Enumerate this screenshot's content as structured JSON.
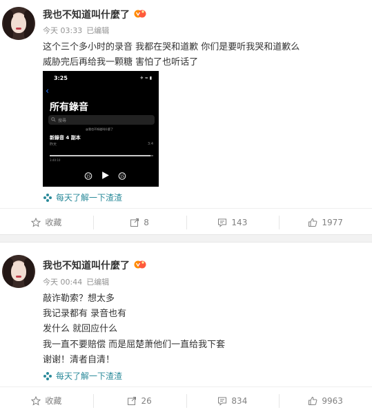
{
  "posts": [
    {
      "username": "我也不知道叫什麼了",
      "time": "今天 03:33",
      "edited": "已编辑",
      "lines": [
        "这个三个多小时的录音 我都在哭和道歉 你们是要听我哭和道歉么",
        "威胁完后再给我一颗糖 害怕了也听话了"
      ],
      "source": "每天了解一下渣渣",
      "actions": {
        "favorite": "收藏",
        "repost": "8",
        "comment": "143",
        "like": "1977"
      },
      "image": {
        "time": "3:25",
        "title": "所有錄音",
        "search_placeholder": "搜尋",
        "watermark": "@我也不知道叫什麼了",
        "recording_name": "新錄音 4 副本",
        "recording_date": "昨天",
        "recording_duration": "3:4",
        "elapsed": "3:40:10",
        "remaining": "",
        "progress": 0.97
      }
    },
    {
      "username": "我也不知道叫什麼了",
      "time": "今天 00:44",
      "edited": "已编辑",
      "lines": [
        "敲诈勒索？想太多",
        "我记录都有 录音也有",
        "发什么 就回应什么",
        "我一直不要赔偿 而是屈楚萧他们一直给我下套",
        "谢谢！清者自清！"
      ],
      "source": "每天了解一下渣渣",
      "actions": {
        "favorite": "收藏",
        "repost": "26",
        "comment": "834",
        "like": "9963"
      }
    }
  ],
  "colors": {
    "text": "#333333",
    "meta": "#939393",
    "source": "#2a8a9a",
    "action": "#808080",
    "separator": "#f2f2f2"
  },
  "icons": [
    "avatar",
    "vip-badge-icon",
    "leaf-icon",
    "star-icon",
    "repost-icon",
    "comment-icon",
    "like-icon",
    "back-chevron-icon",
    "search-icon",
    "skip-back-15-icon",
    "play-icon",
    "skip-forward-15-icon"
  ]
}
